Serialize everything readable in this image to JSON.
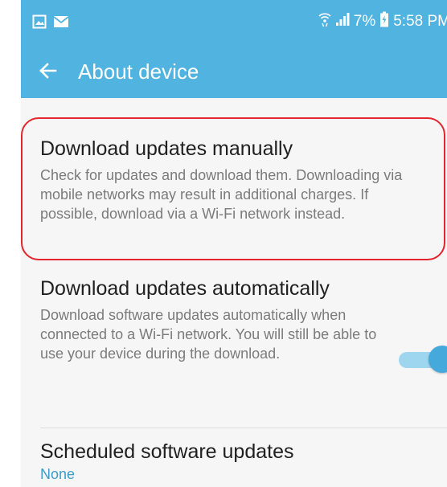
{
  "status_bar": {
    "battery_percent": "7%",
    "time": "5:58 PM",
    "icons": [
      "gallery-notification-icon",
      "mail-notification-icon",
      "wifi-icon",
      "signal-icon",
      "battery-charging-icon"
    ]
  },
  "app_bar": {
    "title": "About device",
    "back_icon": "arrow-left-icon"
  },
  "settings": {
    "manual": {
      "title": "Download updates manually",
      "description": "Check for updates and download them. Downloading via mobile networks may result in additional charges. If possible, download via a Wi-Fi network instead."
    },
    "automatic": {
      "title": "Download updates automatically",
      "description": "Download software updates automatically when connected to a Wi-Fi network. You will still be able to use your device during the download.",
      "toggle_on": true
    },
    "scheduled": {
      "title": "Scheduled software updates",
      "value": "None"
    }
  },
  "colors": {
    "app_bar": "#51b3df",
    "background": "#f6f6f6",
    "accent": "#3f9cc8",
    "highlight": "#e3262d",
    "toggle_thumb": "#45a9dc"
  }
}
